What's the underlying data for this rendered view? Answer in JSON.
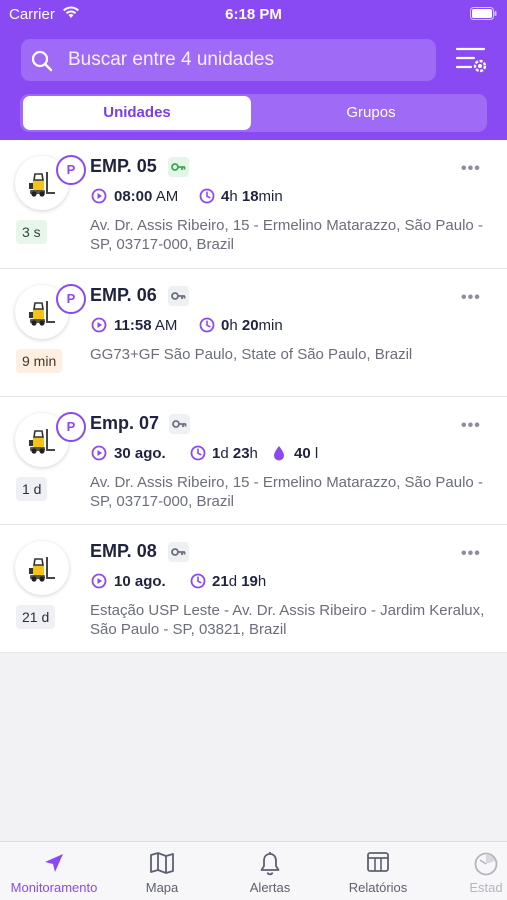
{
  "status_bar": {
    "carrier": "Carrier",
    "time": "6:18 PM"
  },
  "search": {
    "placeholder": "Buscar entre 4 unidades"
  },
  "segments": {
    "units": "Unidades",
    "groups": "Grupos"
  },
  "units": [
    {
      "name": "EMP. 05",
      "parked_badge": "P",
      "ignition": "on",
      "time": "08:00",
      "time_suffix": "AM",
      "dur_a": "4",
      "dur_a_unit": "h",
      "dur_b": "18",
      "dur_b_unit": "min",
      "updated": "3 s",
      "updated_color": "green",
      "address": "Av. Dr. Assis Ribeiro, 15 - Ermelino Matarazzo, São Paulo - SP, 03717-000, Brazil"
    },
    {
      "name": "EMP. 06",
      "parked_badge": "P",
      "ignition": "off",
      "time": "11:58",
      "time_suffix": "AM",
      "dur_a": "0",
      "dur_a_unit": "h",
      "dur_b": "20",
      "dur_b_unit": "min",
      "updated": "9 min",
      "updated_color": "orange",
      "address": "GG73+GF São Paulo, State of São Paulo, Brazil"
    },
    {
      "name": "Emp. 07",
      "parked_badge": "P",
      "ignition": "off",
      "time": "30 ago.",
      "time_suffix": "",
      "dur_a": "1",
      "dur_a_unit": "d",
      "dur_b": "23",
      "dur_b_unit": "h",
      "fuel": "40",
      "fuel_unit": "l",
      "updated": "1 d",
      "updated_color": "gray",
      "address": "Av. Dr. Assis Ribeiro, 15 - Ermelino Matarazzo, São Paulo - SP, 03717-000, Brazil"
    },
    {
      "name": "EMP. 08",
      "parked_badge": "",
      "ignition": "off",
      "time": "10 ago.",
      "time_suffix": "",
      "dur_a": "21",
      "dur_a_unit": "d",
      "dur_b": "19",
      "dur_b_unit": "h",
      "updated": "21 d",
      "updated_color": "gray",
      "address": "Estação USP Leste - Av. Dr. Assis Ribeiro - Jardim Keralux, São Paulo - SP, 03821, Brazil"
    }
  ],
  "tabbar": {
    "monitoring": "Monitoramento",
    "map": "Mapa",
    "alerts": "Alertas",
    "reports": "Relatórios",
    "status": "Estad"
  },
  "colors": {
    "accent": "#8a4af3",
    "text": "#1f2340",
    "muted": "#6b6e7b"
  }
}
